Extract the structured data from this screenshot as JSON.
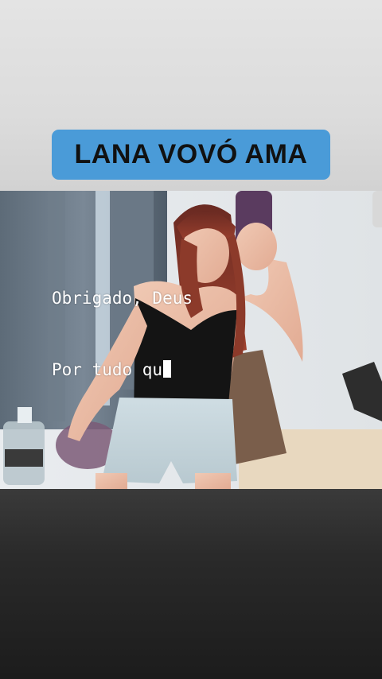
{
  "story": {
    "title": "LANA VOVÓ AMA",
    "caption_lines": [
      "Obrigado, Deus",
      "Por tudo qu"
    ]
  },
  "colors": {
    "title_bg": "#4a9bd8",
    "title_text": "#111111",
    "caption_text": "#ffffff"
  },
  "photo": {
    "subject": "mirror-selfie"
  }
}
